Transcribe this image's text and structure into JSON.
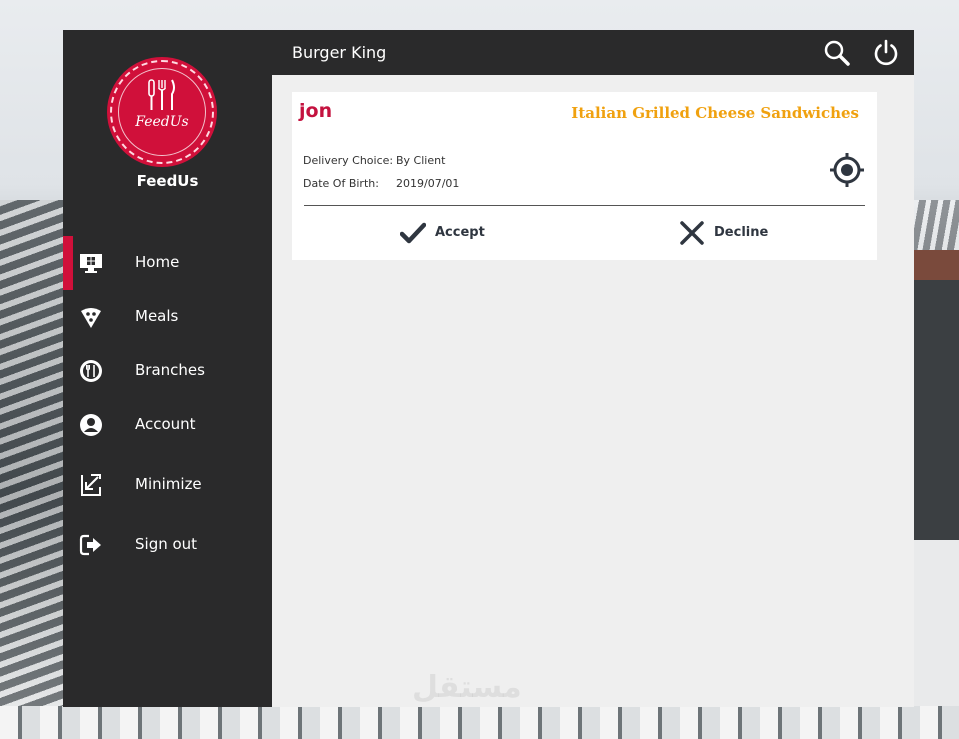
{
  "app": {
    "title": "Burger King"
  },
  "brand": {
    "logo_text": "FeedUs",
    "name": "FeedUs"
  },
  "sidebar": {
    "items": [
      {
        "label": "Home",
        "icon": "monitor-icon",
        "active": true
      },
      {
        "label": "Meals",
        "icon": "pizza-icon",
        "active": false
      },
      {
        "label": "Branches",
        "icon": "restaurant-icon",
        "active": false
      },
      {
        "label": "Account",
        "icon": "user-circle-icon",
        "active": false
      },
      {
        "label": "Minimize",
        "icon": "minimize-icon",
        "active": false
      },
      {
        "label": "Sign out",
        "icon": "sign-out-icon",
        "active": false
      }
    ]
  },
  "topbar": {
    "icons": [
      "search-icon",
      "power-icon"
    ]
  },
  "order": {
    "customer": "jon",
    "meal": "Italian Grilled Cheese Sandwiches",
    "delivery_label": "Delivery Choice:",
    "delivery_value": "By Client",
    "dob_label": "Date Of Birth:",
    "dob_value": "2019/07/01",
    "accept_label": "Accept",
    "decline_label": "Decline"
  },
  "watermark": "مستقل",
  "colors": {
    "sidebar": "#2a2a2b",
    "accent": "#d0103a",
    "meal_text": "#f0a10f",
    "content_bg": "#efefef"
  }
}
